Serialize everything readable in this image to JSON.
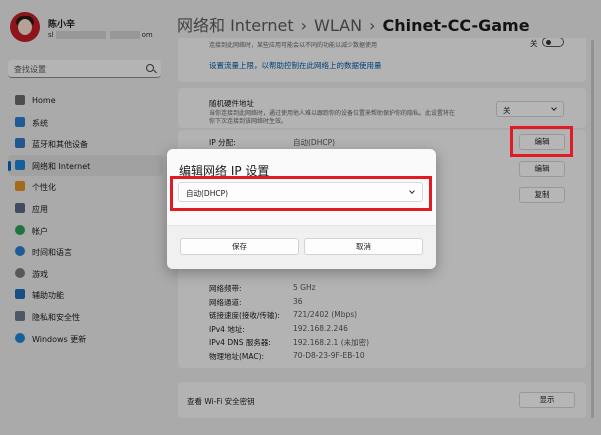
{
  "sidebar": {
    "user": {
      "name": "陈小辛",
      "email_prefix": "sl",
      "email_suffix": "om"
    },
    "search_placeholder": "查找设置",
    "items": [
      {
        "label": "Home",
        "icon": "home-icon",
        "color": "#6a6a6a"
      },
      {
        "label": "系统",
        "icon": "system-icon",
        "color": "#2a7fd1"
      },
      {
        "label": "蓝牙和其他设备",
        "icon": "bluetooth-icon",
        "color": "#3077c9"
      },
      {
        "label": "网络和 Internet",
        "icon": "wifi-icon",
        "color": "#1c86d6"
      },
      {
        "label": "个性化",
        "icon": "brush-icon",
        "color": "#e39427"
      },
      {
        "label": "应用",
        "icon": "apps-icon",
        "color": "#5a6a86"
      },
      {
        "label": "帐户",
        "icon": "account-icon",
        "color": "#2aa05a"
      },
      {
        "label": "时间和语言",
        "icon": "clock-globe-icon",
        "color": "#2a7fd1"
      },
      {
        "label": "游戏",
        "icon": "gamepad-icon",
        "color": "#7a7a7a"
      },
      {
        "label": "辅助功能",
        "icon": "accessibility-icon",
        "color": "#1d6fb8"
      },
      {
        "label": "隐私和安全性",
        "icon": "shield-icon",
        "color": "#6a7a8a"
      },
      {
        "label": "Windows 更新",
        "icon": "update-icon",
        "color": "#1c86d6"
      }
    ],
    "active_index": 3
  },
  "header": {
    "crumbs": [
      "网络和 Internet",
      "WLAN"
    ],
    "current": "Chinet-CC-Game"
  },
  "content": {
    "metered": {
      "desc": "连接到此网络时，某些应用可能会以不同的功能以减少数据使用",
      "toggle": "关"
    },
    "data_limit_link": "设置流量上限，以帮助控制在此网络上的数据使用量",
    "random_mac": {
      "label": "随机硬件地址",
      "desc1": "当你连接到此网络时，通过使用他人难以跟踪你的设备位置来帮助保护你的隐私。此设置将在",
      "desc2": "你下次连接到该网络时生效。",
      "value": "关"
    },
    "ip": {
      "label": "IP 分配:",
      "value": "自动(DHCP)",
      "button": "编辑"
    },
    "dns_button": "编辑",
    "copy_button": "复制",
    "props": [
      {
        "k": "网络频带:",
        "v": "5 GHz"
      },
      {
        "k": "网络通道:",
        "v": "36"
      },
      {
        "k": "链接速度(接收/传输):",
        "v": "721/2402 (Mbps)"
      },
      {
        "k": "IPv4 地址:",
        "v": "192.168.2.246"
      },
      {
        "k": "IPv4 DNS 服务器:",
        "v": "192.168.2.1 (未加密)"
      },
      {
        "k": "物理地址(MAC):",
        "v": "70-D8-23-9F-EB-10"
      }
    ],
    "wifi_key": {
      "label": "查看 Wi-Fi 安全密钥",
      "button": "显示"
    }
  },
  "dialog": {
    "title": "编辑网络 IP 设置",
    "selected": "自动(DHCP)",
    "save": "保存",
    "cancel": "取消"
  },
  "highlight_color": "#e01b24"
}
